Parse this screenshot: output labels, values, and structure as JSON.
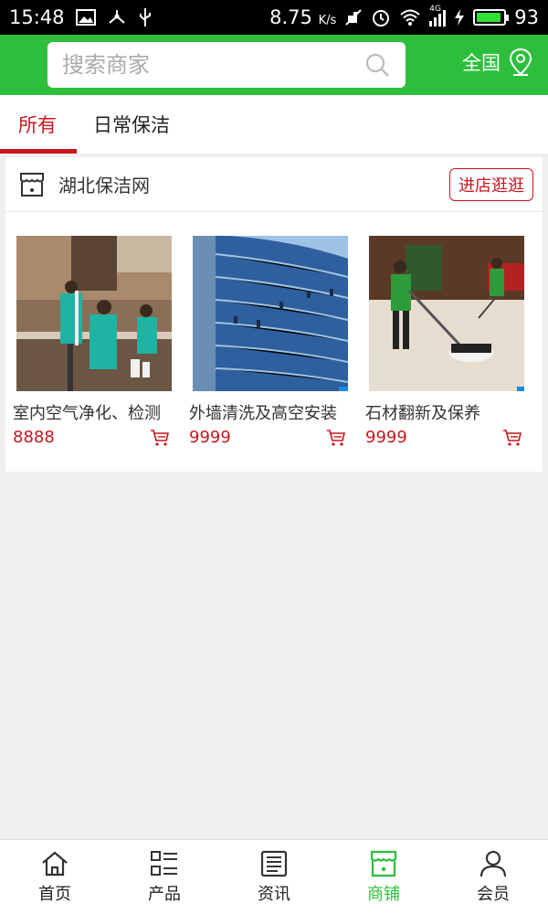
{
  "status": {
    "time": "15:48",
    "speed": "8.75",
    "speed_unit": "K/s",
    "network": "4G",
    "battery": "93"
  },
  "search": {
    "placeholder": "搜索商家"
  },
  "region": {
    "label": "全国"
  },
  "tabs": [
    {
      "label": "所有",
      "active": true
    },
    {
      "label": "日常保洁",
      "active": false
    }
  ],
  "shop": {
    "name": "湖北保洁网",
    "visit_label": "进店逛逛",
    "products": [
      {
        "title": "室内空气净化、检测",
        "price": "8888"
      },
      {
        "title": "外墙清洗及高空安装",
        "price": "9999"
      },
      {
        "title": "石材翻新及保养",
        "price": "9999"
      }
    ]
  },
  "nav": [
    {
      "label": "首页",
      "icon": "home-icon"
    },
    {
      "label": "产品",
      "icon": "list-icon"
    },
    {
      "label": "资讯",
      "icon": "news-icon"
    },
    {
      "label": "商铺",
      "icon": "store-icon",
      "active": true
    },
    {
      "label": "会员",
      "icon": "user-icon"
    }
  ],
  "colors": {
    "brand_green": "#2dbf3c",
    "accent_red": "#c8161d"
  }
}
